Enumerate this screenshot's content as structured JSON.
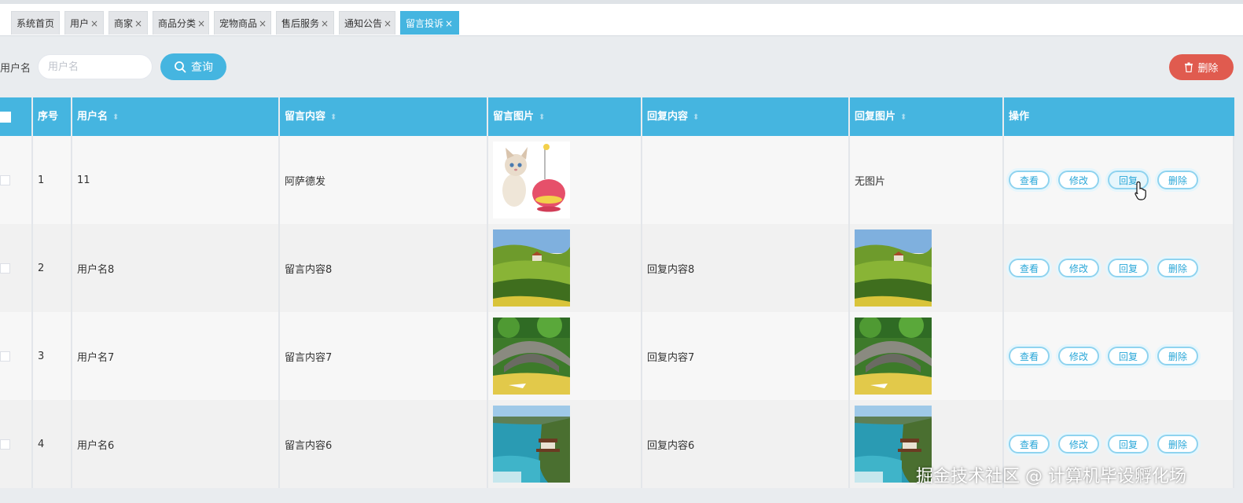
{
  "tabs": [
    {
      "label": "系统首页",
      "closable": false,
      "active": false
    },
    {
      "label": "用户",
      "closable": true,
      "active": false
    },
    {
      "label": "商家",
      "closable": true,
      "active": false
    },
    {
      "label": "商品分类",
      "closable": true,
      "active": false
    },
    {
      "label": "宠物商品",
      "closable": true,
      "active": false
    },
    {
      "label": "售后服务",
      "closable": true,
      "active": false
    },
    {
      "label": "通知公告",
      "closable": true,
      "active": false
    },
    {
      "label": "留言投诉",
      "closable": true,
      "active": true
    }
  ],
  "tab_close_glyph": "×",
  "search": {
    "label": "用户名",
    "placeholder": "用户名",
    "value": ""
  },
  "buttons": {
    "query": "查询",
    "delete": "删除"
  },
  "table": {
    "headers": {
      "index": "序号",
      "username": "用户名",
      "content": "留言内容",
      "image": "留言图片",
      "reply": "回复内容",
      "reply_image": "回复图片",
      "actions": "操作"
    },
    "actions": [
      "查看",
      "修改",
      "回复",
      "删除"
    ],
    "no_image_text": "无图片",
    "rows": [
      {
        "index": "1",
        "username": "11",
        "content": "阿萨德发",
        "image": "kitten-toy",
        "reply": "",
        "reply_image": null
      },
      {
        "index": "2",
        "username": "用户名8",
        "content": "留言内容8",
        "image": "green-hills",
        "reply": "回复内容8",
        "reply_image": "green-hills"
      },
      {
        "index": "3",
        "username": "用户名7",
        "content": "留言内容7",
        "image": "stone-bridge",
        "reply": "回复内容7",
        "reply_image": "stone-bridge"
      },
      {
        "index": "4",
        "username": "用户名6",
        "content": "留言内容6",
        "image": "coastal-pagoda",
        "reply": "回复内容6",
        "reply_image": "coastal-pagoda"
      }
    ]
  },
  "watermark": "掘金技术社区 @ 计算机毕设孵化场",
  "colors": {
    "accent": "#45b5e0",
    "danger": "#e05b4f"
  }
}
